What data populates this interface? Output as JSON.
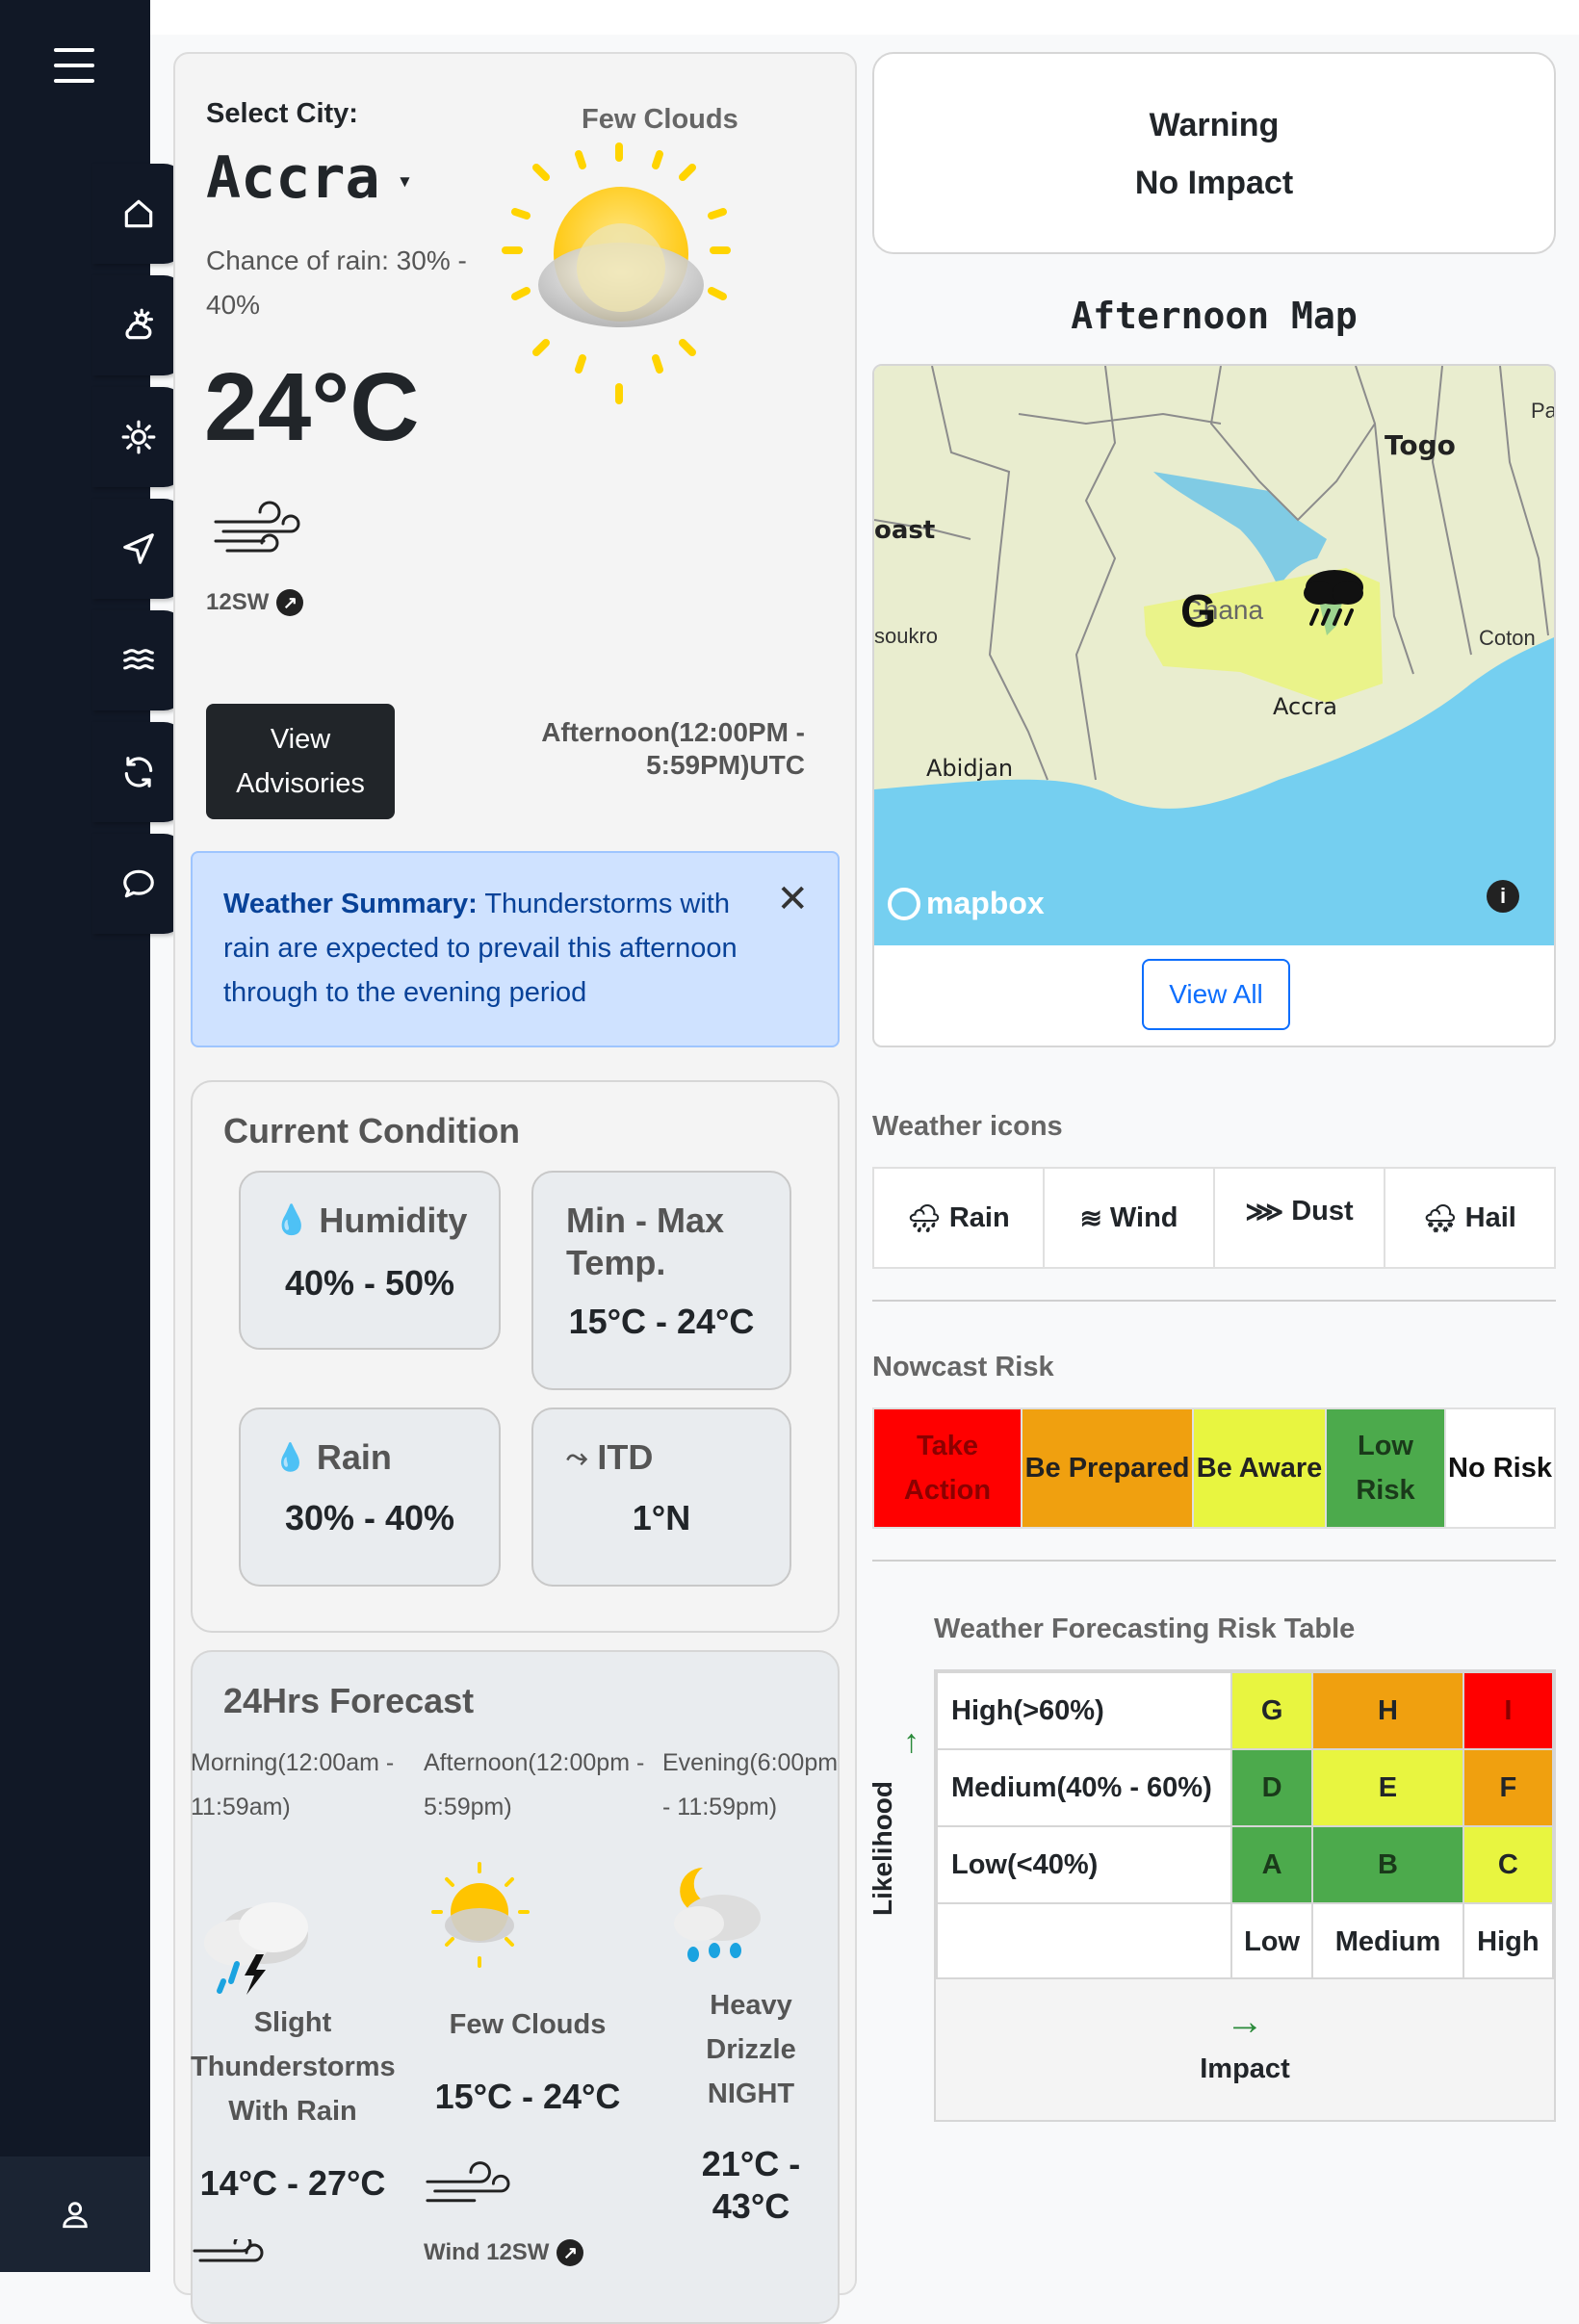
{
  "city": {
    "label": "Select City:",
    "value": "Accra",
    "rain_chance": "Chance of rain: 30% - 40%",
    "condition": "Few Clouds",
    "temperature": "24°C",
    "wind": "12SW",
    "advisory_button": "View Advisories",
    "period": "Afternoon(12:00PM - 5:59PM)UTC"
  },
  "summary": {
    "title": "Weather Summary:",
    "text": " Thunderstorms with rain are expected to prevail this afternoon through to the evening period"
  },
  "current": {
    "title": "Current Condition",
    "humidity_label": "Humidity",
    "humidity_value": "40% - 50%",
    "temp_label": "Min - Max Temp.",
    "temp_value": "15°C - 24°C",
    "rain_label": "Rain",
    "rain_value": "30% - 40%",
    "itd_label": "ITD",
    "itd_value": "1°N"
  },
  "forecast": {
    "title": "24Hrs Forecast",
    "periods": [
      {
        "time": "Morning(12:00am - 11:59am)",
        "condition": "Slight Thunderstorms With Rain",
        "temp": "14°C - 27°C"
      },
      {
        "time": "Afternoon(12:00pm - 5:59pm)",
        "condition": "Few Clouds",
        "temp": "15°C - 24°C",
        "wind": "Wind 12SW"
      },
      {
        "time": "Evening(6:00pm - 11:59pm)",
        "condition": "Heavy Drizzle NIGHT",
        "temp": "21°C - 43°C"
      }
    ]
  },
  "warning": {
    "line1": "Warning",
    "line2": "No Impact"
  },
  "map": {
    "title": "Afternoon Map",
    "labels": {
      "togo": "Togo",
      "coast": "oast",
      "soukro": "soukro",
      "ghana": "Ghana",
      "abidjan": "Abidjan",
      "accra": "Accra",
      "coton": "Coton",
      "para": "Para"
    },
    "logo": "mapbox",
    "view_all": "View All"
  },
  "weather_icons": {
    "title": "Weather icons",
    "items": [
      "Rain",
      "Wind",
      "Dust",
      "Hail"
    ]
  },
  "nowcast": {
    "title": "Nowcast Risk",
    "levels": [
      {
        "label": "Take Action",
        "bg": "#ff0000",
        "fg": "#8b0000"
      },
      {
        "label": "Be Prepared",
        "bg": "#f0a00f",
        "fg": "#222222"
      },
      {
        "label": "Be Aware",
        "bg": "#e8f540",
        "fg": "#222222"
      },
      {
        "label": "Low Risk",
        "bg": "#4caa4c",
        "fg": "#1a3a1a"
      },
      {
        "label": "No Risk",
        "bg": "#ffffff",
        "fg": "#111111"
      }
    ]
  },
  "risk_table": {
    "title": "Weather Forecasting Risk Table",
    "likelihood": "Likelihood",
    "impact": "Impact",
    "rows": [
      {
        "label": "High(>60%)",
        "cells": [
          "G",
          "H",
          "I"
        ]
      },
      {
        "label": "Medium(40% - 60%)",
        "cells": [
          "D",
          "E",
          "F"
        ]
      },
      {
        "label": "Low(<40%)",
        "cells": [
          "A",
          "B",
          "C"
        ]
      }
    ],
    "columns": [
      "Low",
      "Medium",
      "High"
    ]
  }
}
